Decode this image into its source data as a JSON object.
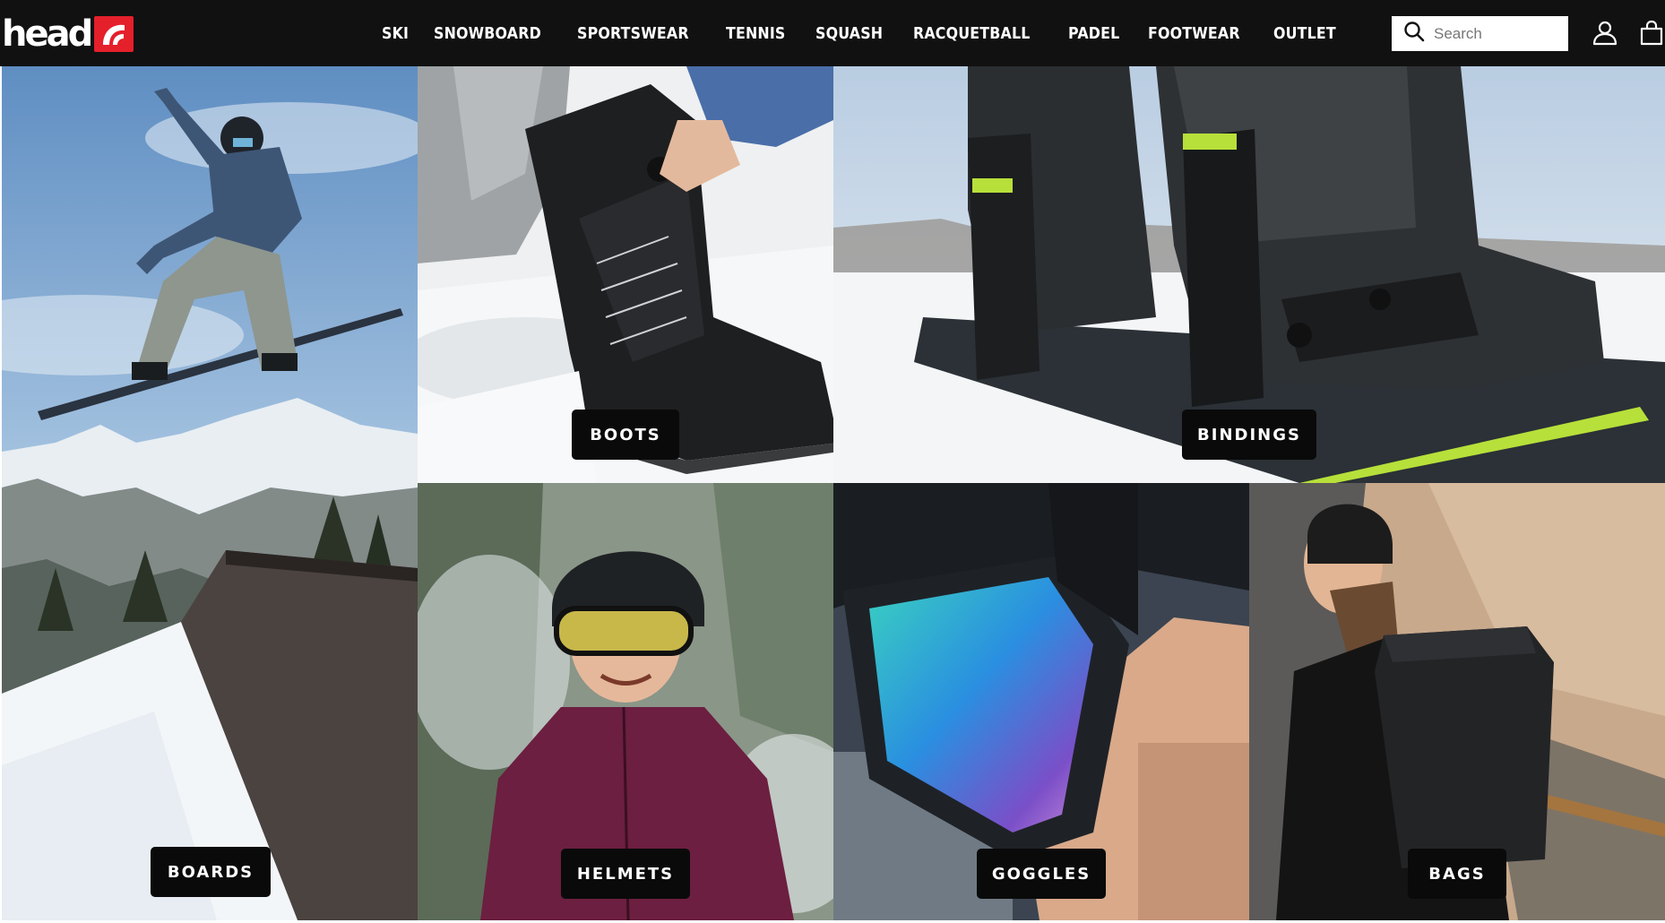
{
  "header": {
    "logo_text": "head",
    "nav": [
      "SKI",
      "SNOWBOARD",
      "SPORTSWEAR",
      "TENNIS",
      "SQUASH",
      "RACQUETBALL",
      "PADEL",
      "FOOTWEAR",
      "OUTLET"
    ],
    "search_placeholder": "Search"
  },
  "icons": {
    "search": "search-icon",
    "account": "user-icon",
    "cart": "shopping-bag-icon",
    "logo_mark": "head-logo-mark"
  },
  "tiles": {
    "boards": "BOARDS",
    "boots": "BOOTS",
    "bindings": "BINDINGS",
    "helmets": "HELMETS",
    "goggles": "GOGGLES",
    "bags": "BAGS"
  },
  "colors": {
    "header_bg": "#111111",
    "brand_red": "#e4202b",
    "label_bg": "#0a0a0a",
    "label_text": "#ffffff"
  }
}
